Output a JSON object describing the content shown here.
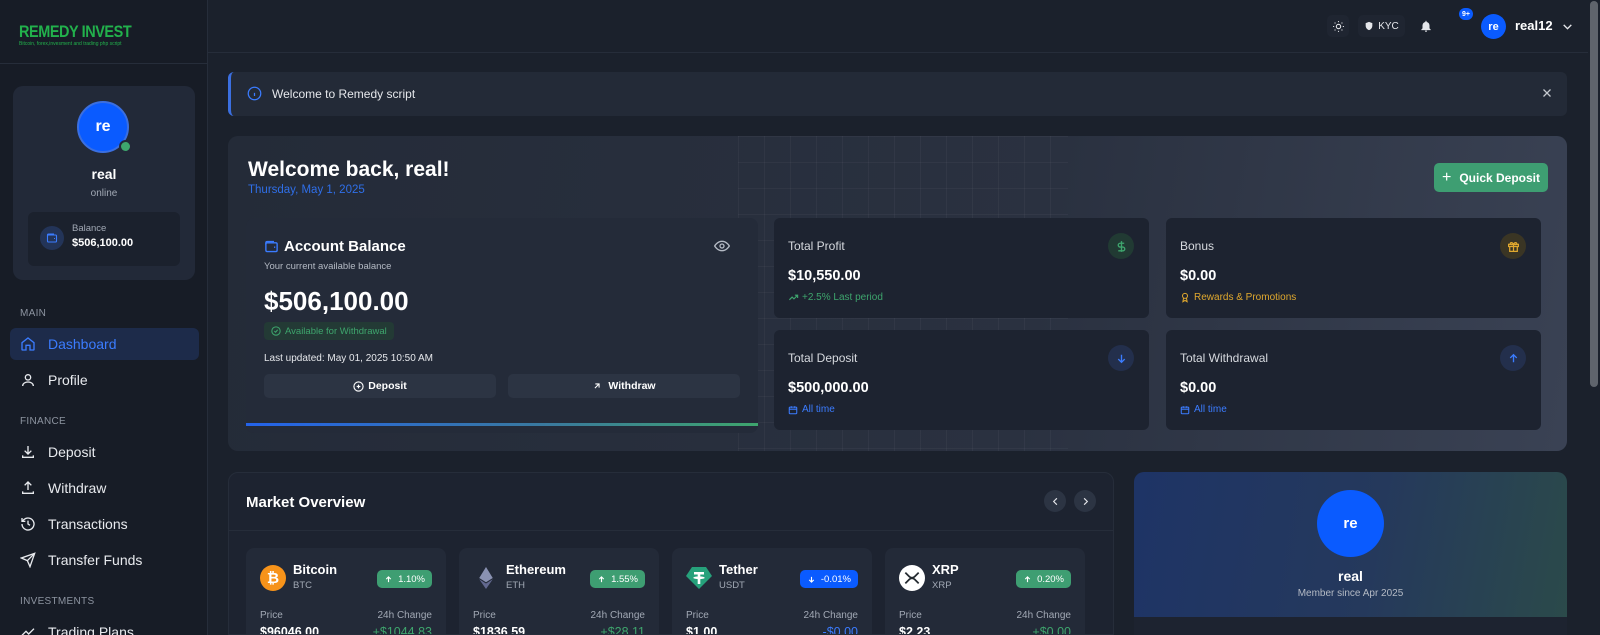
{
  "logo": {
    "main": "REMEDY INVEST",
    "sub": "Bitcoin, forex,invesment and trading php script"
  },
  "sidebar_profile": {
    "initials": "re",
    "name": "real",
    "status": "online",
    "balance_label": "Balance",
    "balance_value": "$506,100.00"
  },
  "nav": {
    "sections": {
      "main": "MAIN",
      "finance": "FINANCE",
      "investments": "INVESTMENTS"
    },
    "items": {
      "dashboard": "Dashboard",
      "profile": "Profile",
      "deposit": "Deposit",
      "withdraw": "Withdraw",
      "transactions": "Transactions",
      "transfer": "Transfer Funds",
      "trading": "Trading Plans"
    }
  },
  "topbar": {
    "kyc": "KYC",
    "notif_count": "9+",
    "initials": "re",
    "username": "real12"
  },
  "alert": {
    "text": "Welcome to Remedy script"
  },
  "hero": {
    "title": "Welcome back, real!",
    "date": "Thursday, May 1, 2025",
    "quick_deposit": "Quick Deposit"
  },
  "balance": {
    "title": "Account Balance",
    "subtitle": "Your current available balance",
    "value": "$506,100.00",
    "available": "Available for Withdrawal",
    "updated": "Last updated: May 01, 2025 10:50 AM",
    "deposit": "Deposit",
    "withdraw": "Withdraw"
  },
  "stats": {
    "profit": {
      "label": "Total Profit",
      "value": "$10,550.00",
      "foot": "+2.5% Last period",
      "color": "#3ea56d"
    },
    "bonus": {
      "label": "Bonus",
      "value": "$0.00",
      "foot": "Rewards & Promotions",
      "color": "#e0a82e"
    },
    "deposit": {
      "label": "Total Deposit",
      "value": "$500,000.00",
      "foot": "All time",
      "color": "#3b7cff"
    },
    "withdrawal": {
      "label": "Total Withdrawal",
      "value": "$0.00",
      "foot": "All time",
      "color": "#3b7cff"
    }
  },
  "market": {
    "title": "Market Overview",
    "price_label": "Price",
    "change_label": "24h Change",
    "coins": [
      {
        "name": "Bitcoin",
        "symbol": "BTC",
        "change": "1.10%",
        "price": "$96046.00",
        "change_value": "+$1044.83"
      },
      {
        "name": "Ethereum",
        "symbol": "ETH",
        "change": "1.55%",
        "price": "$1836.59",
        "change_value": "+$28.11"
      },
      {
        "name": "Tether",
        "symbol": "USDT",
        "change": "-0.01%",
        "price": "$1.00",
        "change_value": "-$0.00"
      },
      {
        "name": "XRP",
        "symbol": "XRP",
        "change": "0.20%",
        "price": "$2.23",
        "change_value": "+$0.00"
      }
    ]
  },
  "member": {
    "initials": "re",
    "name": "real",
    "since": "Member since Apr 2025"
  }
}
